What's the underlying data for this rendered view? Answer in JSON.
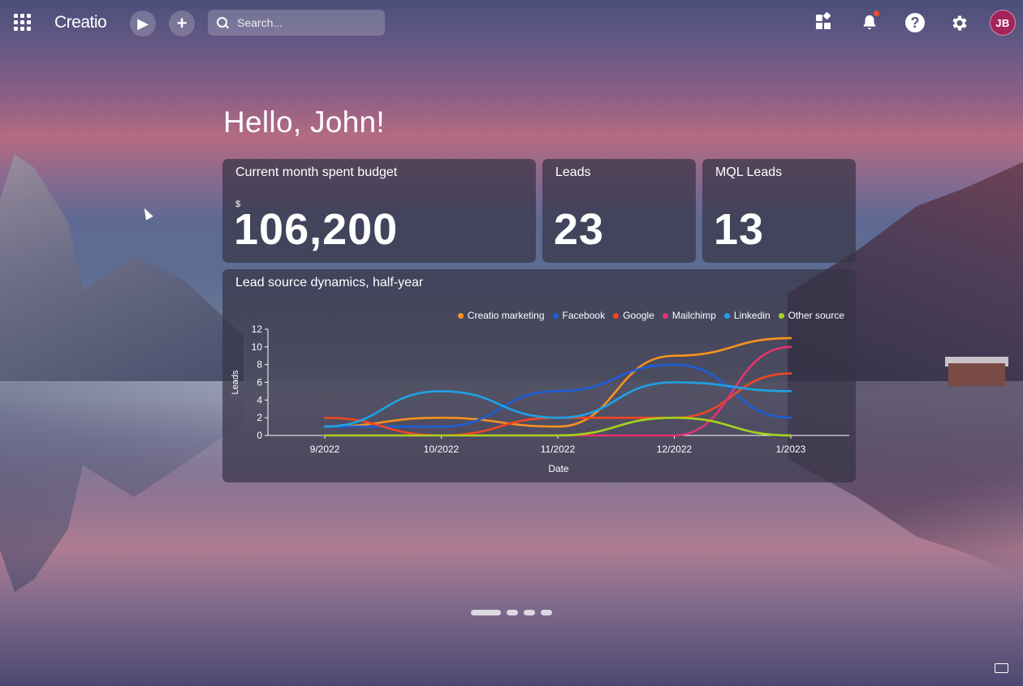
{
  "topbar": {
    "logo": "Creatio",
    "run_icon": "play-icon",
    "add_icon": "plus-icon",
    "add_label": "+",
    "run_label": "▶",
    "search": {
      "placeholder": "Search..."
    },
    "avatar_initials": "JB",
    "notification_dot_color": "#f04e2f",
    "avatar_color": "#a2245b"
  },
  "greeting": "Hello, John!",
  "widgets": {
    "budget": {
      "title": "Current month spent budget",
      "currency": "$",
      "value": "106,200"
    },
    "leads": {
      "title": "Leads",
      "value": "23"
    },
    "mql": {
      "title": "MQL Leads",
      "value": "13"
    }
  },
  "chart": {
    "title": "Lead source dynamics, half-year",
    "legend": [
      {
        "name": "Creatio marketing",
        "color": "#f7931e"
      },
      {
        "name": "Facebook",
        "color": "#1d5ed8"
      },
      {
        "name": "Google",
        "color": "#ef4723"
      },
      {
        "name": "Mailchimp",
        "color": "#e5336e"
      },
      {
        "name": "Linkedin",
        "color": "#1ea2e6"
      },
      {
        "name": "Other source",
        "color": "#a4d41d"
      }
    ]
  },
  "chart_data": {
    "type": "line",
    "title": "Lead source dynamics, half-year",
    "xlabel": "Date",
    "ylabel": "Leads",
    "categories": [
      "9/2022",
      "10/2022",
      "11/2022",
      "12/2022",
      "1/2023"
    ],
    "ylim": [
      0,
      12
    ],
    "yticks": [
      0,
      2,
      4,
      6,
      8,
      10,
      12
    ],
    "legend_position": "top-right",
    "series": [
      {
        "name": "Creatio marketing",
        "color": "#f7931e",
        "values": [
          1,
          2,
          1,
          9,
          11
        ]
      },
      {
        "name": "Facebook",
        "color": "#1d5ed8",
        "values": [
          1,
          1,
          5,
          8,
          2
        ]
      },
      {
        "name": "Google",
        "color": "#ef4723",
        "values": [
          2,
          0,
          2,
          2,
          7
        ]
      },
      {
        "name": "Mailchimp",
        "color": "#e5336e",
        "values": [
          0,
          0,
          0,
          0,
          10
        ]
      },
      {
        "name": "Linkedin",
        "color": "#1ea2e6",
        "values": [
          1,
          5,
          2,
          6,
          5
        ]
      },
      {
        "name": "Other source",
        "color": "#a4d41d",
        "values": [
          0,
          0,
          0,
          2,
          0
        ]
      }
    ]
  },
  "pager": {
    "active": 1,
    "count": 4
  }
}
